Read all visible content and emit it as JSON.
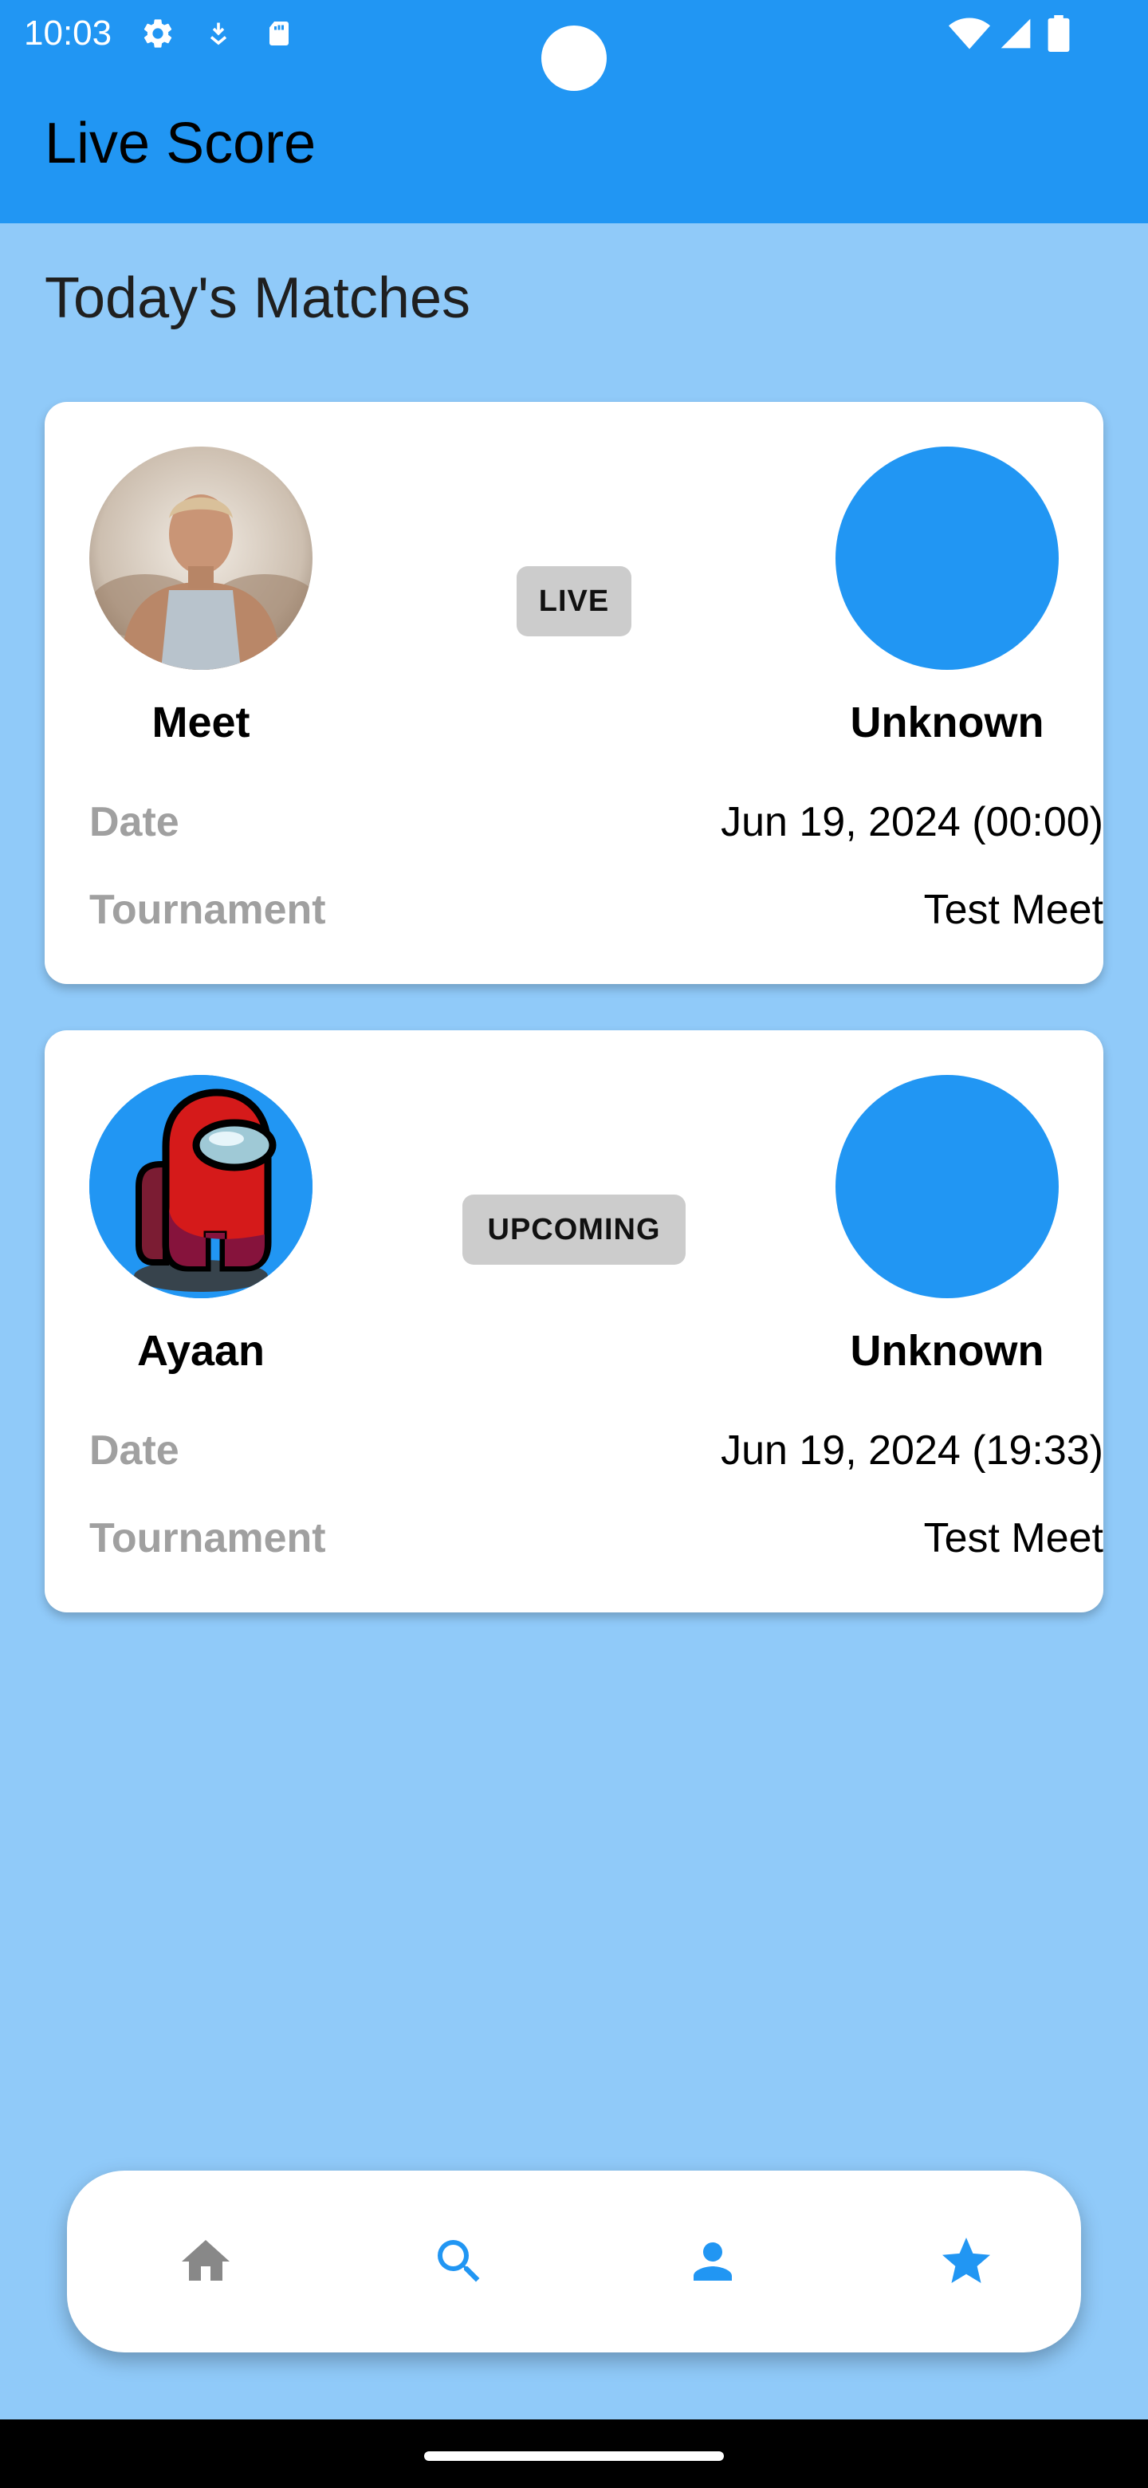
{
  "status_bar": {
    "time": "10:03",
    "left_icons": [
      "gear-icon",
      "download-icon",
      "sd-card-icon"
    ],
    "right_icons": [
      "wifi-icon",
      "signal-icon",
      "battery-icon"
    ]
  },
  "app_bar": {
    "title": "Live Score",
    "color": "#2196F3"
  },
  "page": {
    "background": "#90CAF9",
    "section_title": "Today's Matches"
  },
  "matches": [
    {
      "player1": {
        "name": "Meet",
        "avatar": "photo"
      },
      "player2": {
        "name": "Unknown",
        "avatar": "blue-placeholder"
      },
      "status": "LIVE",
      "date_label": "Date",
      "date_value": "Jun 19, 2024 (00:00)",
      "tournament_label": "Tournament",
      "tournament_value": "Test Meet"
    },
    {
      "player1": {
        "name": "Ayaan",
        "avatar": "red-crewmate"
      },
      "player2": {
        "name": "Unknown",
        "avatar": "blue-placeholder"
      },
      "status": "UPCOMING",
      "date_label": "Date",
      "date_value": "Jun 19, 2024 (19:33)",
      "tournament_label": "Tournament",
      "tournament_value": "Test Meet"
    }
  ],
  "bottom_nav": {
    "items": [
      {
        "icon": "home-icon",
        "active": false,
        "color": "#888888"
      },
      {
        "icon": "search-icon",
        "active": true,
        "color": "#2196F3"
      },
      {
        "icon": "person-icon",
        "active": true,
        "color": "#2196F3"
      },
      {
        "icon": "star-icon",
        "active": true,
        "color": "#2196F3"
      }
    ]
  }
}
